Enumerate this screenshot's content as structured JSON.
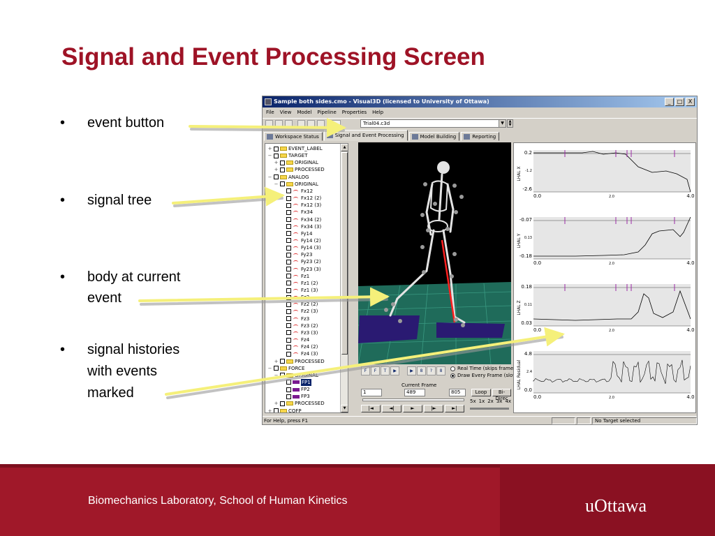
{
  "slide": {
    "title": "Signal and Event Processing Screen",
    "bullets": [
      {
        "lines": [
          "event button"
        ]
      },
      {
        "lines": [
          "signal tree"
        ]
      },
      {
        "lines": [
          "body at current",
          "event"
        ]
      },
      {
        "lines": [
          "signal histories",
          "with events",
          "marked"
        ]
      }
    ],
    "bullet_glyph": "•",
    "arrow_color": "#f5f07a"
  },
  "window": {
    "title": "Sample both sides.cmo - Visual3D (licensed to University of Ottawa)",
    "controls": [
      "_",
      "□",
      "X"
    ],
    "menu": [
      "File",
      "View",
      "Model",
      "Pipeline",
      "Properties",
      "Help"
    ],
    "toolbar_icons": [
      "new-icon",
      "open-icon",
      "save-icon",
      "print-icon",
      "cut-icon",
      "copy-icon",
      "event-icon"
    ],
    "trial_combo_value": "Trial04.c3d",
    "tabs": [
      {
        "label": "Workspace Status",
        "active": false
      },
      {
        "label": "Signal and Event Processing",
        "active": true
      },
      {
        "label": "Model Building",
        "active": false
      },
      {
        "label": "Reporting",
        "active": false
      }
    ],
    "tree": [
      {
        "label": "EVENT_LABEL",
        "level": 0,
        "exp": "+",
        "icon": "folder"
      },
      {
        "label": "TARGET",
        "level": 0,
        "exp": "−",
        "icon": "folder"
      },
      {
        "label": "ORIGINAL",
        "level": 1,
        "exp": "+",
        "icon": "folder"
      },
      {
        "label": "PROCESSED",
        "level": 1,
        "exp": "+",
        "icon": "folder"
      },
      {
        "label": "ANALOG",
        "level": 0,
        "exp": "−",
        "icon": "folder"
      },
      {
        "label": "ORIGINAL",
        "level": 1,
        "exp": "−",
        "icon": "folder"
      },
      {
        "label": "Fx12",
        "level": 2,
        "exp": "",
        "icon": "signal"
      },
      {
        "label": "Fx12 (2)",
        "level": 2,
        "exp": "",
        "icon": "signal"
      },
      {
        "label": "Fx12 (3)",
        "level": 2,
        "exp": "",
        "icon": "signal"
      },
      {
        "label": "Fx34",
        "level": 2,
        "exp": "",
        "icon": "signal"
      },
      {
        "label": "Fx34 (2)",
        "level": 2,
        "exp": "",
        "icon": "signal"
      },
      {
        "label": "Fx34 (3)",
        "level": 2,
        "exp": "",
        "icon": "signal"
      },
      {
        "label": "Fy14",
        "level": 2,
        "exp": "",
        "icon": "signal"
      },
      {
        "label": "Fy14 (2)",
        "level": 2,
        "exp": "",
        "icon": "signal"
      },
      {
        "label": "Fy14 (3)",
        "level": 2,
        "exp": "",
        "icon": "signal"
      },
      {
        "label": "Fy23",
        "level": 2,
        "exp": "",
        "icon": "signal"
      },
      {
        "label": "Fy23 (2)",
        "level": 2,
        "exp": "",
        "icon": "signal"
      },
      {
        "label": "Fy23 (3)",
        "level": 2,
        "exp": "",
        "icon": "signal"
      },
      {
        "label": "Fz1",
        "level": 2,
        "exp": "",
        "icon": "signal"
      },
      {
        "label": "Fz1 (2)",
        "level": 2,
        "exp": "",
        "icon": "signal"
      },
      {
        "label": "Fz1 (3)",
        "level": 2,
        "exp": "",
        "icon": "signal"
      },
      {
        "label": "Fz2",
        "level": 2,
        "exp": "",
        "icon": "signal"
      },
      {
        "label": "Fz2 (2)",
        "level": 2,
        "exp": "",
        "icon": "signal"
      },
      {
        "label": "Fz2 (3)",
        "level": 2,
        "exp": "",
        "icon": "signal"
      },
      {
        "label": "Fz3",
        "level": 2,
        "exp": "",
        "icon": "signal"
      },
      {
        "label": "Fz3 (2)",
        "level": 2,
        "exp": "",
        "icon": "signal"
      },
      {
        "label": "Fz3 (3)",
        "level": 2,
        "exp": "",
        "icon": "signal"
      },
      {
        "label": "Fz4",
        "level": 2,
        "exp": "",
        "icon": "signal"
      },
      {
        "label": "Fz4 (2)",
        "level": 2,
        "exp": "",
        "icon": "signal"
      },
      {
        "label": "Fz4 (3)",
        "level": 2,
        "exp": "",
        "icon": "signal"
      },
      {
        "label": "PROCESSED",
        "level": 1,
        "exp": "+",
        "icon": "folder"
      },
      {
        "label": "FORCE",
        "level": 0,
        "exp": "−",
        "icon": "folder"
      },
      {
        "label": "ORIGINAL",
        "level": 1,
        "exp": "−",
        "icon": "folder"
      },
      {
        "label": "FP1",
        "level": 2,
        "exp": "",
        "icon": "plate",
        "selected": true
      },
      {
        "label": "FP2",
        "level": 2,
        "exp": "",
        "icon": "plate"
      },
      {
        "label": "FP3",
        "level": 2,
        "exp": "",
        "icon": "plate"
      },
      {
        "label": "PROCESSED",
        "level": 1,
        "exp": "+",
        "icon": "folder"
      },
      {
        "label": "COFP",
        "level": 0,
        "exp": "+",
        "icon": "folder"
      }
    ],
    "animation": {
      "buttons_top": [
        "F",
        "F",
        "T",
        "▶"
      ],
      "buttons_mid": [
        "▶",
        "8",
        "?",
        "8"
      ],
      "radio_realtime": "Real Time (skips frames)",
      "radio_every": "Draw Every Frame (slow)",
      "current_frame_label": "Current Frame",
      "start_frame": "1",
      "current_frame": "489",
      "end_frame": "805",
      "loop_button": "Loop",
      "bidir_button": "Bi-Direc",
      "speeds": [
        "5x",
        "1x",
        "2x",
        "3x",
        "4x",
        "1"
      ],
      "transport": [
        "|◄",
        "◄|",
        "►",
        "|►",
        "►|"
      ]
    },
    "status": {
      "help": "For Help, press F1",
      "target": "No Target selected"
    }
  },
  "plots": [
    {
      "ylabel": "LHAL X",
      "yticks": [
        "0.2",
        "-1.2",
        "-2.6"
      ],
      "xticks": [
        "0.0",
        "2.0",
        "4.0"
      ]
    },
    {
      "ylabel": "LHAL Y",
      "yticks": [
        "-0.07",
        "0.13",
        "-0.18"
      ],
      "xticks": [
        "0.0",
        "2.0",
        "4.0"
      ]
    },
    {
      "ylabel": "LHAL Z",
      "yticks": [
        "0.18",
        "0.11",
        "0.03"
      ],
      "xticks": [
        "0.0",
        "2.0",
        "4.0"
      ]
    },
    {
      "ylabel": "LHAL Residual",
      "yticks": [
        "4.8",
        "2.4",
        "0.0"
      ],
      "xticks": [
        "0.0",
        "2.0",
        "4.0"
      ]
    }
  ],
  "footer": {
    "caption": "Biomechanics Laboratory, School of Human Kinetics",
    "logo_text": "uOttawa",
    "colors": {
      "footer": "#a01829",
      "footer_right": "#8a1122"
    }
  },
  "colors": {
    "title": "#9e1326"
  }
}
